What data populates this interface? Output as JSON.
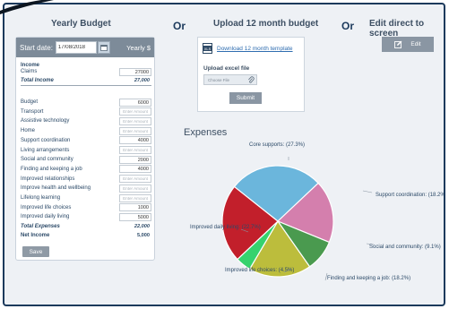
{
  "headings": {
    "yearly_budget": "Yearly Budget",
    "or_1": "Or",
    "upload": "Upload 12 month budget",
    "or_2": "Or",
    "edit_direct": "Edit direct to screen"
  },
  "budget": {
    "start_label": "Start date:",
    "start_date": "17/08/2018",
    "yearly_label": "Yearly $",
    "income_header": "Income",
    "income_rows": [
      {
        "label": "Claims",
        "value": "27000"
      }
    ],
    "total_income_label": "Total Income",
    "total_income_value": "27,000",
    "expense_rows": [
      {
        "label": "Budget",
        "value": "6000",
        "placeholder": false
      },
      {
        "label": "Transport",
        "value": "Enter Amount",
        "placeholder": true
      },
      {
        "label": "Assistive technology",
        "value": "Enter Amount",
        "placeholder": true
      },
      {
        "label": "Home",
        "value": "Enter Amount",
        "placeholder": true
      },
      {
        "label": "Support coordination",
        "value": "4000",
        "placeholder": false
      },
      {
        "label": "Living arrangements",
        "value": "Enter Amount",
        "placeholder": true
      },
      {
        "label": "Social and community",
        "value": "2000",
        "placeholder": false
      },
      {
        "label": "Finding and keeping a job",
        "value": "4000",
        "placeholder": false
      },
      {
        "label": "Improved relationships",
        "value": "Enter Amount",
        "placeholder": true
      },
      {
        "label": "Improve health and wellbeing",
        "value": "Enter Amount",
        "placeholder": true
      },
      {
        "label": "Lifelong learning",
        "value": "Enter Amount",
        "placeholder": true
      },
      {
        "label": "Improved life choices",
        "value": "1000",
        "placeholder": false
      },
      {
        "label": "Improved daily living",
        "value": "5000",
        "placeholder": false
      }
    ],
    "total_expenses_label": "Total Expenses",
    "total_expenses_value": "22,000",
    "net_income_label": "Net Income",
    "net_income_value": "5,000",
    "save_label": "Save"
  },
  "upload": {
    "download_link": "Download 12 month template",
    "upload_label": "Upload excel file",
    "file_placeholder": "Choose File",
    "submit_label": "Submit"
  },
  "edit": {
    "edit_label": "Edit"
  },
  "chart_data": {
    "type": "pie",
    "title": "Expenses",
    "slices": [
      {
        "label": "Core supports:",
        "pct_label": "(27.3%)",
        "value": 27.3,
        "color": "#6bb6dc"
      },
      {
        "label": "Support coordination:",
        "pct_label": "(18.2%)",
        "value": 18.2,
        "color": "#d47fad"
      },
      {
        "label": "Social and community:",
        "pct_label": "(9.1%)",
        "value": 9.1,
        "color": "#4a9a4f"
      },
      {
        "label": "Finding and keeping a job:",
        "pct_label": "(18.2%)",
        "value": 18.2,
        "color": "#bcbd3c"
      },
      {
        "label": "Improved life choices:",
        "pct_label": "(4.5%)",
        "value": 4.5,
        "color": "#36d26e"
      },
      {
        "label": "Improved daily living:",
        "pct_label": "(22.7%)",
        "value": 22.7,
        "color": "#c21f2b"
      }
    ]
  }
}
